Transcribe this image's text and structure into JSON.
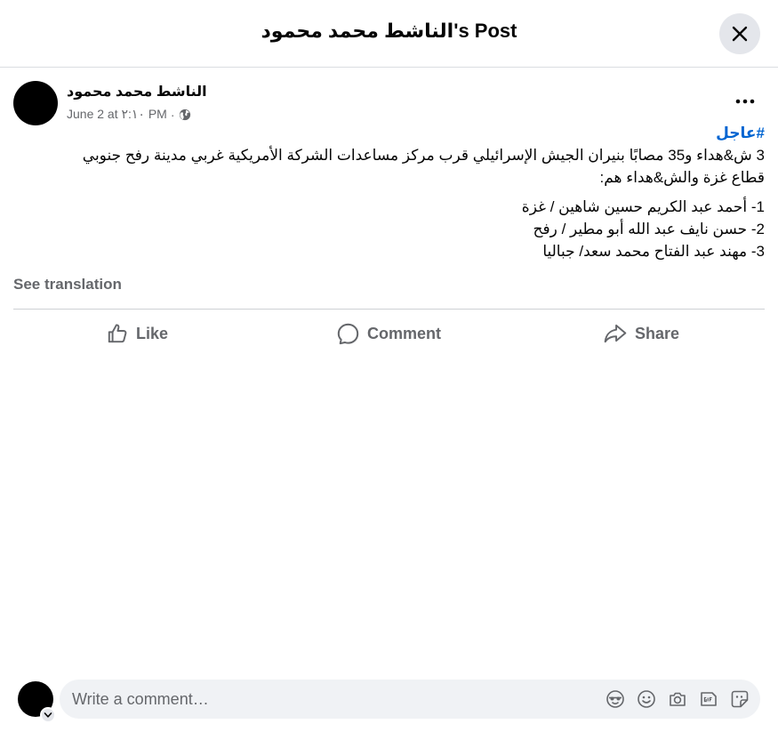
{
  "dialog": {
    "title": "الناشط محمد محمود's Post"
  },
  "post": {
    "author": "الناشط محمد محمود",
    "date": "June 2 at ٢:١٠ PM",
    "date_separator": "·",
    "hashtag": "#عاجل",
    "paragraph_line1": "3 ش&هداء و35 مصابًا بنيران الجيش الإسرائيلي قرب مركز مساعدات الشركة الأمريكية غربي مدينة رفح جنوبي",
    "paragraph_line2": "قطاع غزة والش&هداء هم:",
    "names": [
      "1- أحمد عبد الكريم حسين شاهين / غزة",
      "2- حسن نايف عبد الله أبو مطير / رفح",
      "3- مهند عبد الفتاح محمد سعد/ جباليا"
    ],
    "see_translation": "See translation"
  },
  "actions": {
    "like": "Like",
    "comment": "Comment",
    "share": "Share"
  },
  "composer": {
    "placeholder": "Write a comment…",
    "icons": [
      "avatar-sticker-icon",
      "emoji-icon",
      "camera-icon",
      "gif-icon",
      "sticker-icon"
    ]
  },
  "colors": {
    "hashtag": "#0064d1",
    "secondary_text": "#65676b",
    "close_button_bg": "#e4e6eb",
    "composer_bg": "#f0f2f5"
  }
}
